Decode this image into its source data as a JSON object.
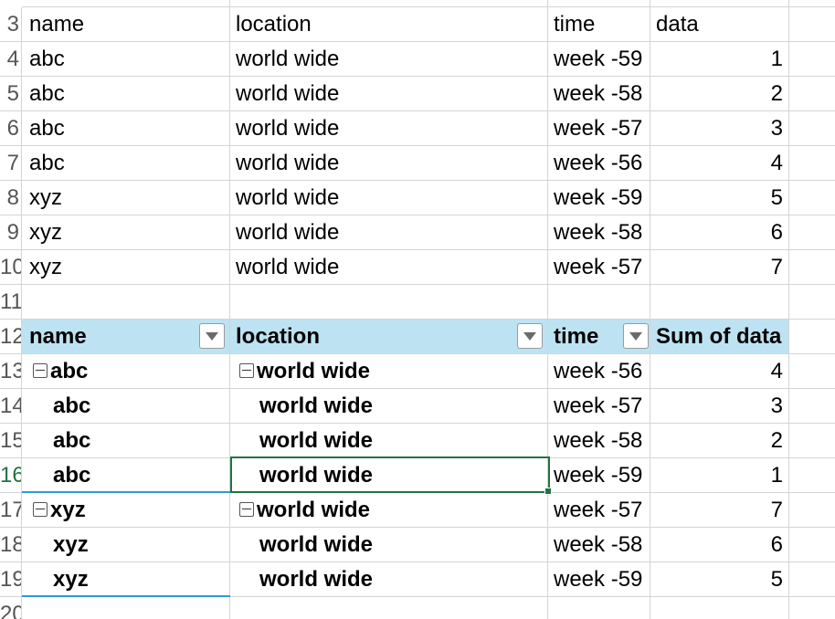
{
  "row_numbers": [
    "3",
    "4",
    "5",
    "6",
    "7",
    "8",
    "9",
    "10",
    "11",
    "12",
    "13",
    "14",
    "15",
    "16",
    "17",
    "18",
    "19",
    "20"
  ],
  "active_row": "16",
  "source_table": {
    "headers": [
      "name",
      "location",
      "time",
      "data"
    ],
    "rows": [
      [
        "abc",
        "world wide",
        "week -59",
        "1"
      ],
      [
        "abc",
        "world wide",
        "week -58",
        "2"
      ],
      [
        "abc",
        "world wide",
        "week -57",
        "3"
      ],
      [
        "abc",
        "world wide",
        "week -56",
        "4"
      ],
      [
        "xyz",
        "world wide",
        "week -59",
        "5"
      ],
      [
        "xyz",
        "world wide",
        "week -58",
        "6"
      ],
      [
        "xyz",
        "world wide",
        "week -57",
        "7"
      ]
    ]
  },
  "pivot": {
    "headers": [
      "name",
      "location",
      "time",
      "Sum of data"
    ],
    "rows": [
      {
        "name": "abc",
        "location": "world wide",
        "time": "week -56",
        "value": "4",
        "group_start": true
      },
      {
        "name": "abc",
        "location": "world wide",
        "time": "week -57",
        "value": "3",
        "group_start": false
      },
      {
        "name": "abc",
        "location": "world wide",
        "time": "week -58",
        "value": "2",
        "group_start": false
      },
      {
        "name": "abc",
        "location": "world wide",
        "time": "week -59",
        "value": "1",
        "group_start": false
      },
      {
        "name": "xyz",
        "location": "world wide",
        "time": "week -57",
        "value": "7",
        "group_start": true
      },
      {
        "name": "xyz",
        "location": "world wide",
        "time": "week -58",
        "value": "6",
        "group_start": false
      },
      {
        "name": "xyz",
        "location": "world wide",
        "time": "week -59",
        "value": "5",
        "group_start": false
      }
    ]
  },
  "colors": {
    "accent": "#217346",
    "pivot_header": "#bde3f2",
    "gridline": "#d4d4d4"
  }
}
